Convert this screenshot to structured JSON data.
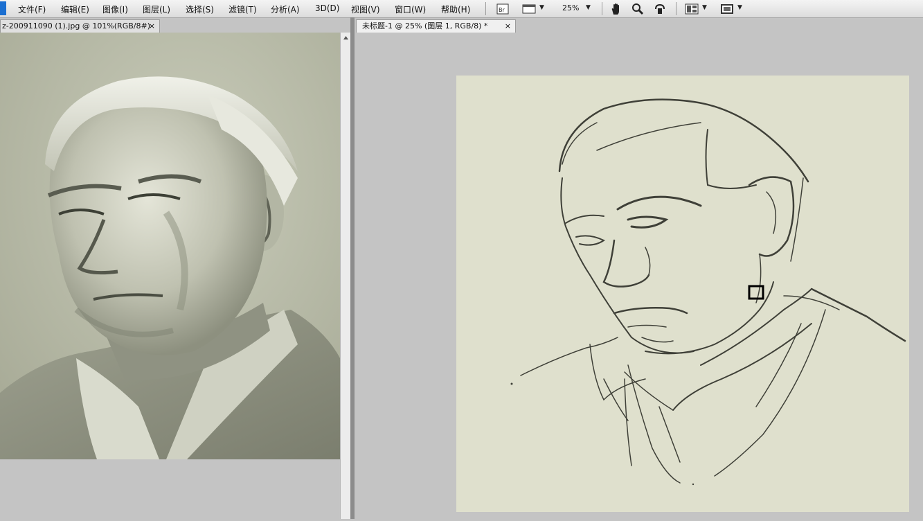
{
  "menu": {
    "items": [
      "文件(F)",
      "编辑(E)",
      "图像(I)",
      "图层(L)",
      "选择(S)",
      "滤镜(T)",
      "分析(A)",
      "3D(D)",
      "视图(V)",
      "窗口(W)",
      "帮助(H)"
    ],
    "zoom": "25%"
  },
  "toolbar": {
    "icons": [
      "bridge-icon",
      "screen-mode-icon",
      "hand-icon",
      "zoom-icon",
      "rotate-view-icon",
      "arrange-icon",
      "fit-screen-icon"
    ]
  },
  "tabs": {
    "left": {
      "label": "z-200911090 (1).jpg @ 101%(RGB/8#)",
      "close": "×"
    },
    "right": {
      "label": "未标题-1 @ 25% (图层 1, RGB/8) *",
      "close": "×"
    }
  },
  "colors": {
    "photo_bg": "#b4b7a4",
    "canvas_bg": "#dfe0cd",
    "sketch_stroke": "#3f4038",
    "accent": "#1b6fd1"
  }
}
